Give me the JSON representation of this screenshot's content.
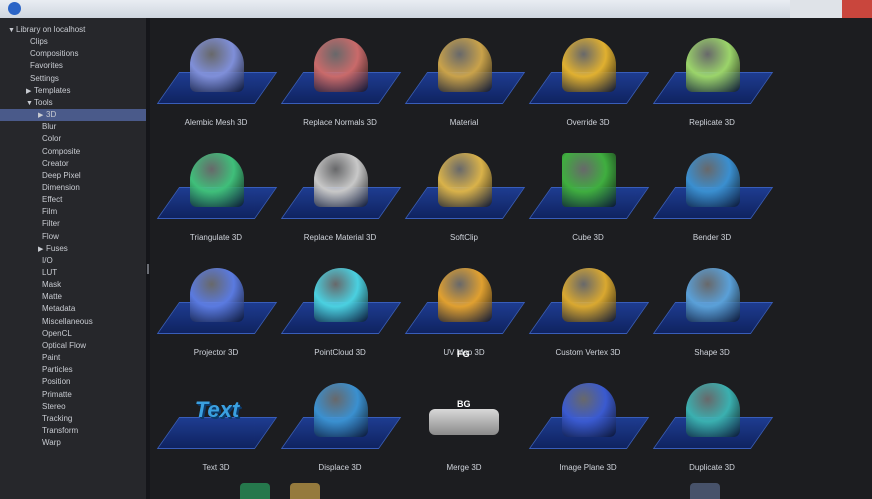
{
  "window": {
    "title": ""
  },
  "sidebar": {
    "items": [
      {
        "label": "Library on localhost",
        "indent": 0,
        "arrow": "down"
      },
      {
        "label": "Clips",
        "indent": 1,
        "arrow": ""
      },
      {
        "label": "Compositions",
        "indent": 1,
        "arrow": ""
      },
      {
        "label": "Favorites",
        "indent": 1,
        "arrow": ""
      },
      {
        "label": "Settings",
        "indent": 1,
        "arrow": ""
      },
      {
        "label": "Templates",
        "indent": 1,
        "arrow": "right"
      },
      {
        "label": "Tools",
        "indent": 1,
        "arrow": "down"
      },
      {
        "label": "3D",
        "indent": 2,
        "arrow": "right",
        "selected": true
      },
      {
        "label": "Blur",
        "indent": 2,
        "arrow": ""
      },
      {
        "label": "Color",
        "indent": 2,
        "arrow": ""
      },
      {
        "label": "Composite",
        "indent": 2,
        "arrow": ""
      },
      {
        "label": "Creator",
        "indent": 2,
        "arrow": ""
      },
      {
        "label": "Deep Pixel",
        "indent": 2,
        "arrow": ""
      },
      {
        "label": "Dimension",
        "indent": 2,
        "arrow": ""
      },
      {
        "label": "Effect",
        "indent": 2,
        "arrow": ""
      },
      {
        "label": "Film",
        "indent": 2,
        "arrow": ""
      },
      {
        "label": "Filter",
        "indent": 2,
        "arrow": ""
      },
      {
        "label": "Flow",
        "indent": 2,
        "arrow": ""
      },
      {
        "label": "Fuses",
        "indent": 2,
        "arrow": "right"
      },
      {
        "label": "I/O",
        "indent": 2,
        "arrow": ""
      },
      {
        "label": "LUT",
        "indent": 2,
        "arrow": ""
      },
      {
        "label": "Mask",
        "indent": 2,
        "arrow": ""
      },
      {
        "label": "Matte",
        "indent": 2,
        "arrow": ""
      },
      {
        "label": "Metadata",
        "indent": 2,
        "arrow": ""
      },
      {
        "label": "Miscellaneous",
        "indent": 2,
        "arrow": ""
      },
      {
        "label": "OpenCL",
        "indent": 2,
        "arrow": ""
      },
      {
        "label": "Optical Flow",
        "indent": 2,
        "arrow": ""
      },
      {
        "label": "Paint",
        "indent": 2,
        "arrow": ""
      },
      {
        "label": "Particles",
        "indent": 2,
        "arrow": ""
      },
      {
        "label": "Position",
        "indent": 2,
        "arrow": ""
      },
      {
        "label": "Primatte",
        "indent": 2,
        "arrow": ""
      },
      {
        "label": "Stereo",
        "indent": 2,
        "arrow": ""
      },
      {
        "label": "Tracking",
        "indent": 2,
        "arrow": ""
      },
      {
        "label": "Transform",
        "indent": 2,
        "arrow": ""
      },
      {
        "label": "Warp",
        "indent": 2,
        "arrow": ""
      }
    ]
  },
  "tools": [
    {
      "label": "Alembic Mesh 3D",
      "icon": "alembic-mesh-icon",
      "color": "#7f8fd9"
    },
    {
      "label": "Replace Normals 3D",
      "icon": "replace-normals-icon",
      "color": "#c96a6a"
    },
    {
      "label": "Material",
      "icon": "folder-icon",
      "color": "#c9a24a"
    },
    {
      "label": "Override 3D",
      "icon": "override-icon",
      "color": "#e0b030"
    },
    {
      "label": "Replicate 3D",
      "icon": "replicate-icon",
      "color": "#9bd46a"
    },
    {
      "label": "Triangulate 3D",
      "icon": "triangulate-icon",
      "color": "#3fbf7a"
    },
    {
      "label": "Replace Material 3D",
      "icon": "replace-material-icon",
      "color": "#c8c8c8"
    },
    {
      "label": "SoftClip",
      "icon": "softclip-icon",
      "color": "#d9b24a"
    },
    {
      "label": "Cube 3D",
      "icon": "cube-icon",
      "color": "#3fae3f"
    },
    {
      "label": "Bender 3D",
      "icon": "bender-icon",
      "color": "#3a8fd0"
    },
    {
      "label": "Projector 3D",
      "icon": "projector-icon",
      "color": "#5a7ae0"
    },
    {
      "label": "PointCloud 3D",
      "icon": "pointcloud-icon",
      "color": "#4ad0e0"
    },
    {
      "label": "UV Map 3D",
      "icon": "uv-map-icon",
      "color": "#e0a030"
    },
    {
      "label": "Custom Vertex 3D",
      "icon": "custom-vertex-icon",
      "color": "#d9a830"
    },
    {
      "label": "Shape 3D",
      "icon": "shape-icon",
      "color": "#5aa0d8"
    },
    {
      "label": "Text 3D",
      "icon": "text-3d-icon",
      "color": "#3aa0e0"
    },
    {
      "label": "Displace 3D",
      "icon": "displace-icon",
      "color": "#3a90d0"
    },
    {
      "label": "Merge 3D",
      "icon": "merge-icon",
      "color": "#9a9a9a",
      "fg": "FG",
      "bg": "BG"
    },
    {
      "label": "Image Plane 3D",
      "icon": "image-plane-icon",
      "color": "#3a5ad0"
    },
    {
      "label": "Duplicate 3D",
      "icon": "duplicate-icon",
      "color": "#3ab0b0"
    }
  ]
}
